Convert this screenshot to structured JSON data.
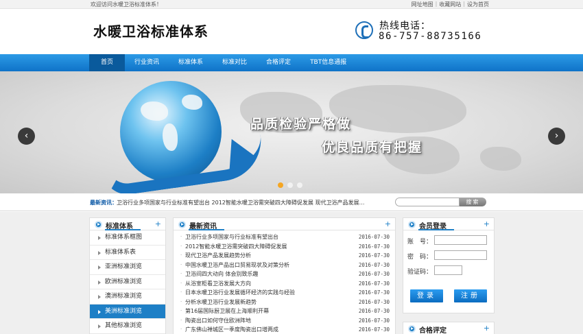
{
  "topbar": {
    "welcome": "欢迎访问水暖卫浴标准体系！",
    "links": [
      "网址地图",
      "收藏网站",
      "设为首页"
    ]
  },
  "header": {
    "logo": "水暖卫浴标准体系",
    "hotline_label": "热线电话：",
    "hotline_number": "86-757-88735166"
  },
  "nav": {
    "items": [
      "首页",
      "行业资讯",
      "标准体系",
      "标准对比",
      "合格评定",
      "TBT信息通报"
    ],
    "active_index": 0
  },
  "banner": {
    "slogan_line1": "品质检验严格做",
    "slogan_line2": "优良品质有把握",
    "prev_glyph": "‹",
    "next_glyph": "›",
    "active_slide": 1,
    "slide_count": 3
  },
  "ticker": {
    "label": "最新资讯：",
    "text": "卫浴行业多项国家与行业标准有望出台    2012智能水暖卫浴需突破四大障碍促发展    现代卫浴产品发展…",
    "search_placeholder": "",
    "search_button": "搜索"
  },
  "sidebar": {
    "title": "标准体系",
    "plus": "+",
    "items": [
      "标准体系框图",
      "标准体系表",
      "亚洲标准浏览",
      "欧洲标准浏览",
      "澳洲标准浏览",
      "美洲标准浏览",
      "其他标准浏览"
    ],
    "active_index": 5
  },
  "news": {
    "title": "最新资讯",
    "plus": "+",
    "bullet": "·",
    "items": [
      {
        "title": "卫浴行业多项国家与行业标准有望出台",
        "date": "2016-07-30"
      },
      {
        "title": "2012智能水暖卫浴需突破四大障碍促发展",
        "date": "2016-07-30"
      },
      {
        "title": "现代卫浴产品发展趋势分析",
        "date": "2016-07-30"
      },
      {
        "title": "中国水暖卫浴产品出口贸易现状及对策分析",
        "date": "2016-07-30"
      },
      {
        "title": "卫浴间四大动向 体会别致乐趣",
        "date": "2016-07-30"
      },
      {
        "title": "从浴室柜看卫浴发展大方向",
        "date": "2016-07-30"
      },
      {
        "title": "日本水暖卫浴行业发展循环经济的实践与经验",
        "date": "2016-07-30"
      },
      {
        "title": "分析水暖卫浴行业发展新趋势",
        "date": "2016-07-30"
      },
      {
        "title": "第16届国际厨卫展在上海顺利开幕",
        "date": "2016-07-30"
      },
      {
        "title": "陶瓷出口如何守住欧洲阵地",
        "date": "2016-07-30"
      },
      {
        "title": "广东佛山禅城区一季度陶瓷出口增两成",
        "date": "2016-07-30"
      }
    ]
  },
  "login": {
    "title": "会员登录",
    "plus": "+",
    "account_label": "账　号：",
    "password_label": "密　码：",
    "captcha_label": "验证码：",
    "login_button": "登录",
    "register_button": "注册"
  },
  "standard_panel": {
    "title": "合格评定",
    "plus": "+"
  }
}
